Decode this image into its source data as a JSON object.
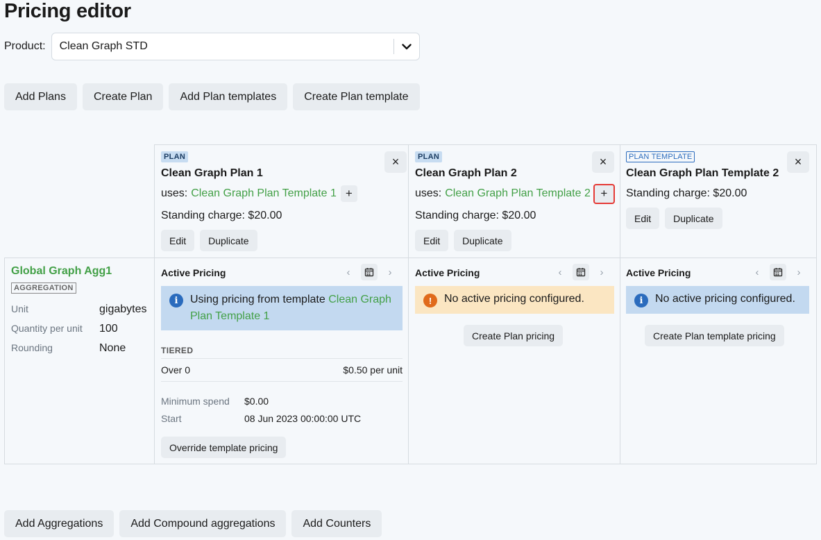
{
  "page": {
    "title": "Pricing editor"
  },
  "product": {
    "label": "Product:",
    "value": "Clean Graph STD"
  },
  "top_actions": [
    "Add Plans",
    "Create Plan",
    "Add Plan templates",
    "Create Plan template"
  ],
  "bottom_actions": [
    "Add Aggregations",
    "Add Compound aggregations",
    "Add Counters"
  ],
  "plans": [
    {
      "badge": "PLAN",
      "name": "Clean Graph Plan 1",
      "uses_label": "uses:",
      "uses_template": "Clean Graph Plan Template 1",
      "standing_charge": "Standing charge: $20.00",
      "edit": "Edit",
      "duplicate": "Duplicate"
    },
    {
      "badge": "PLAN",
      "name": "Clean Graph Plan 2",
      "uses_label": "uses:",
      "uses_template": "Clean Graph Plan Template 2",
      "standing_charge": "Standing charge: $20.00",
      "edit": "Edit",
      "duplicate": "Duplicate"
    },
    {
      "badge": "PLAN TEMPLATE",
      "name": "Clean Graph Plan Template 2",
      "standing_charge": "Standing charge: $20.00",
      "edit": "Edit",
      "duplicate": "Duplicate"
    }
  ],
  "aggregation": {
    "name": "Global Graph Agg1",
    "badge": "AGGREGATION",
    "rows": [
      {
        "key": "Unit",
        "value": "gigabytes"
      },
      {
        "key": "Quantity per unit",
        "value": "100"
      },
      {
        "key": "Rounding",
        "value": "None"
      }
    ]
  },
  "pricing": [
    {
      "title": "Active Pricing",
      "alert_prefix": "Using pricing from template",
      "alert_link": "Clean Graph Plan Template 1",
      "tier_label": "TIERED",
      "tier_range": "Over 0",
      "tier_price": "$0.50 per unit",
      "min_spend_label": "Minimum spend",
      "min_spend_value": "$0.00",
      "start_label": "Start",
      "start_value": "08 Jun 2023 00:00:00 UTC",
      "action": "Override template pricing"
    },
    {
      "title": "Active Pricing",
      "alert": "No active pricing configured.",
      "action": "Create Plan pricing"
    },
    {
      "title": "Active Pricing",
      "alert": "No active pricing configured.",
      "action": "Create Plan template pricing"
    }
  ],
  "icons": {
    "close": "×",
    "plus": "+",
    "prev": "‹",
    "next": "›",
    "info": "i",
    "warn": "!"
  },
  "colors": {
    "link_green": "#43a047",
    "info_bg": "#c3d9f0",
    "warn_bg": "#fbe6c2",
    "highlight": "#e53935"
  }
}
